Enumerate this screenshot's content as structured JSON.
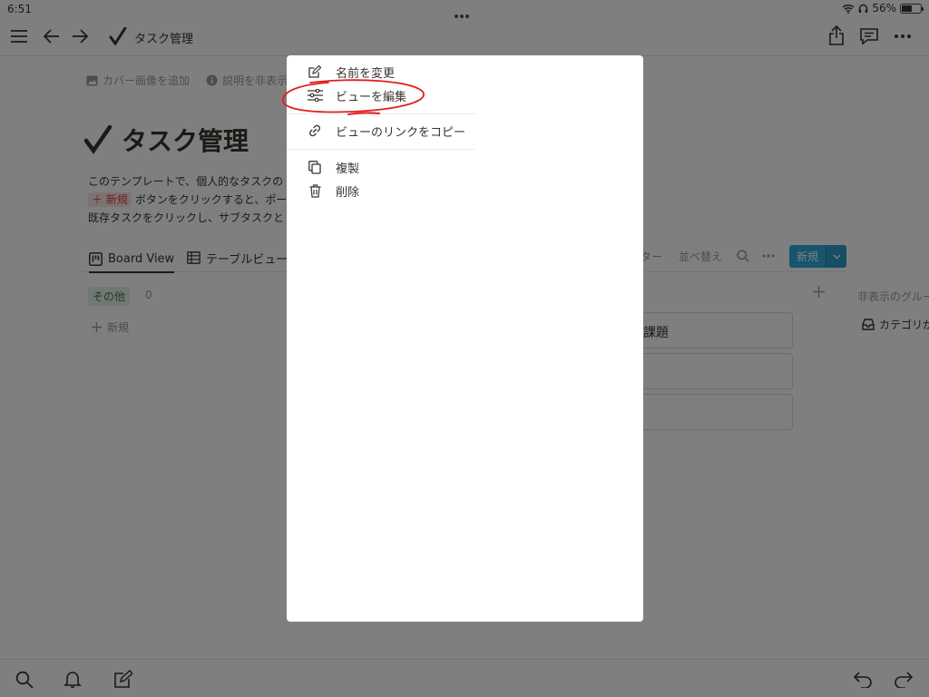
{
  "status": {
    "time": "6:51",
    "battery": "56%",
    "battery_level": 0.56
  },
  "nav": {
    "title": "タスク管理"
  },
  "page": {
    "add_cover": "カバー画像を追加",
    "hide_description": "説明を非表示",
    "title": "タスク管理",
    "desc_line1": "このテンプレートで、個人的なタスクの",
    "desc_new_tag": "＋ 新規",
    "desc_line2": "ボタンをクリックすると、ポー",
    "desc_line3": "既存タスクをクリックし、サブタスクと"
  },
  "views": {
    "board_view": "Board View",
    "table_view": "テーブルビュー",
    "filter_partial": "ター",
    "sort": "並べ替え",
    "new_button": "新規"
  },
  "board": {
    "group_tag": "その他",
    "group_count": "0",
    "add_new": "新規",
    "cards": [
      "課題",
      "",
      ""
    ],
    "hidden_groups": "非表示のグルー",
    "category": "カテゴリが"
  },
  "menu": {
    "items": [
      {
        "label": "名前を変更",
        "icon": "rename-icon"
      },
      {
        "label": "ビューを編集",
        "icon": "sliders-icon"
      },
      {
        "label": "ビューのリンクをコピー",
        "icon": "link-icon"
      },
      {
        "label": "複製",
        "icon": "duplicate-icon"
      },
      {
        "label": "削除",
        "icon": "trash-icon"
      }
    ],
    "annotation_color": "#e02020"
  }
}
